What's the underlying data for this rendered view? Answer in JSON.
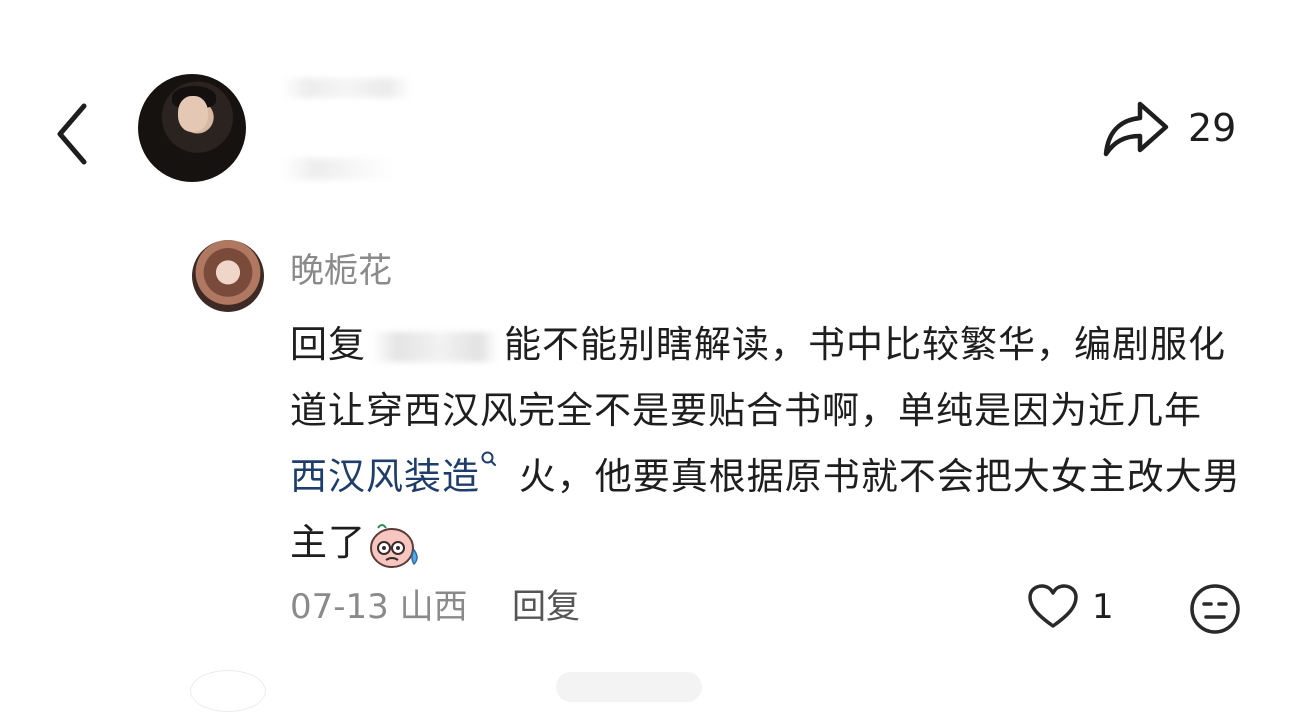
{
  "header": {
    "back_icon": "chevron-left-icon",
    "share_icon": "share-arrow-icon",
    "share_count": "29"
  },
  "comment": {
    "author": "晚栀花",
    "reply_prefix": "回复",
    "text_before_link": "能不能别瞎解读，书中比较繁华，编剧服化道让穿西汉风完全不是要贴合书啊，单纯是因为近几年 ",
    "topic_link": "西汉风装造",
    "text_after_link": " 火，他要真根据原书就不会把大女主改大男主了",
    "emoji": "sweat-face-emoji",
    "date_location": "07-13 山西",
    "reply_label": "回复",
    "like_count": "1",
    "like_icon": "heart-outline-icon",
    "dislike_icon": "unhappy-face-icon"
  },
  "colors": {
    "text": "#1e1e1e",
    "muted": "#8a8a8a",
    "link": "#1f3d6b"
  }
}
